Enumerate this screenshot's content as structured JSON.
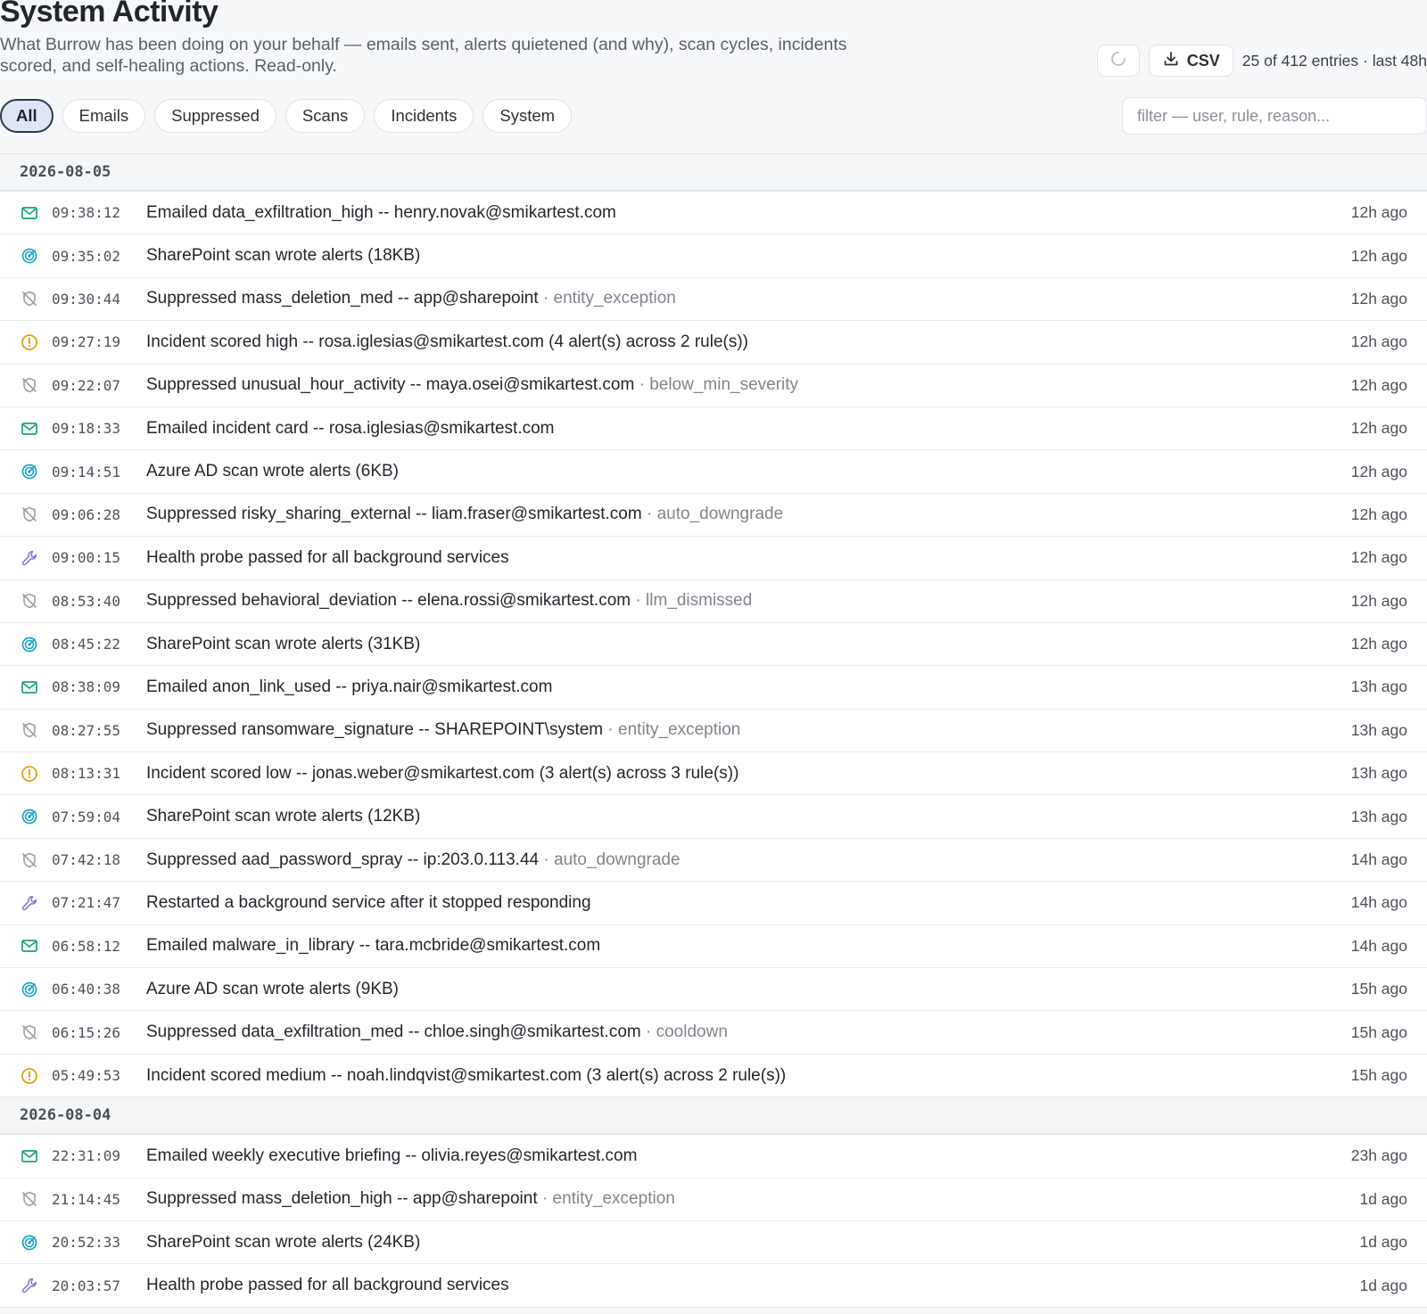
{
  "page": {
    "title": "System Activity",
    "subtitle": "What Burrow has been doing on your behalf — emails sent, alerts quietened (and why), scan cycles, incidents scored, and self-healing actions. Read-only.",
    "csv_label": "CSV",
    "entries_text": "25 of 412 entries · last 48h"
  },
  "filters": {
    "chips": [
      "All",
      "Emails",
      "Suppressed",
      "Scans",
      "Incidents",
      "System"
    ],
    "active": "All",
    "placeholder": "filter — user, rule, reason..."
  },
  "colors": {
    "email": "#1aa37a",
    "scan": "#1ba3c6",
    "suppressed": "#9aa0a8",
    "incident": "#e3a008",
    "system": "#8b6fd1"
  },
  "groups": [
    {
      "date": "2026-08-05",
      "rows": [
        {
          "type": "email",
          "time": "09:38:12",
          "msg": "Emailed data_exfiltration_high -- henry.novak@smikartest.com",
          "reason": "",
          "ago": "12h ago"
        },
        {
          "type": "scan",
          "time": "09:35:02",
          "msg": "SharePoint scan wrote alerts (18KB)",
          "reason": "",
          "ago": "12h ago"
        },
        {
          "type": "suppressed",
          "time": "09:30:44",
          "msg": "Suppressed mass_deletion_med -- app@sharepoint",
          "reason": "entity_exception",
          "ago": "12h ago"
        },
        {
          "type": "incident",
          "time": "09:27:19",
          "msg": "Incident scored high -- rosa.iglesias@smikartest.com (4 alert(s) across 2 rule(s))",
          "reason": "",
          "ago": "12h ago"
        },
        {
          "type": "suppressed",
          "time": "09:22:07",
          "msg": "Suppressed unusual_hour_activity -- maya.osei@smikartest.com",
          "reason": "below_min_severity",
          "ago": "12h ago"
        },
        {
          "type": "email",
          "time": "09:18:33",
          "msg": "Emailed incident card -- rosa.iglesias@smikartest.com",
          "reason": "",
          "ago": "12h ago"
        },
        {
          "type": "scan",
          "time": "09:14:51",
          "msg": "Azure AD scan wrote alerts (6KB)",
          "reason": "",
          "ago": "12h ago"
        },
        {
          "type": "suppressed",
          "time": "09:06:28",
          "msg": "Suppressed risky_sharing_external -- liam.fraser@smikartest.com",
          "reason": "auto_downgrade",
          "ago": "12h ago"
        },
        {
          "type": "system",
          "time": "09:00:15",
          "msg": "Health probe passed for all background services",
          "reason": "",
          "ago": "12h ago"
        },
        {
          "type": "suppressed",
          "time": "08:53:40",
          "msg": "Suppressed behavioral_deviation -- elena.rossi@smikartest.com",
          "reason": "llm_dismissed",
          "ago": "12h ago"
        },
        {
          "type": "scan",
          "time": "08:45:22",
          "msg": "SharePoint scan wrote alerts (31KB)",
          "reason": "",
          "ago": "12h ago"
        },
        {
          "type": "email",
          "time": "08:38:09",
          "msg": "Emailed anon_link_used -- priya.nair@smikartest.com",
          "reason": "",
          "ago": "13h ago"
        },
        {
          "type": "suppressed",
          "time": "08:27:55",
          "msg": "Suppressed ransomware_signature -- SHAREPOINT\\system",
          "reason": "entity_exception",
          "ago": "13h ago"
        },
        {
          "type": "incident",
          "time": "08:13:31",
          "msg": "Incident scored low -- jonas.weber@smikartest.com (3 alert(s) across 3 rule(s))",
          "reason": "",
          "ago": "13h ago"
        },
        {
          "type": "scan",
          "time": "07:59:04",
          "msg": "SharePoint scan wrote alerts (12KB)",
          "reason": "",
          "ago": "13h ago"
        },
        {
          "type": "suppressed",
          "time": "07:42:18",
          "msg": "Suppressed aad_password_spray -- ip:203.0.113.44",
          "reason": "auto_downgrade",
          "ago": "14h ago"
        },
        {
          "type": "system",
          "time": "07:21:47",
          "msg": "Restarted a background service after it stopped responding",
          "reason": "",
          "ago": "14h ago"
        },
        {
          "type": "email",
          "time": "06:58:12",
          "msg": "Emailed malware_in_library -- tara.mcbride@smikartest.com",
          "reason": "",
          "ago": "14h ago"
        },
        {
          "type": "scan",
          "time": "06:40:38",
          "msg": "Azure AD scan wrote alerts (9KB)",
          "reason": "",
          "ago": "15h ago"
        },
        {
          "type": "suppressed",
          "time": "06:15:26",
          "msg": "Suppressed data_exfiltration_med -- chloe.singh@smikartest.com",
          "reason": "cooldown",
          "ago": "15h ago"
        },
        {
          "type": "incident",
          "time": "05:49:53",
          "msg": "Incident scored medium -- noah.lindqvist@smikartest.com (3 alert(s) across 2 rule(s))",
          "reason": "",
          "ago": "15h ago"
        }
      ]
    },
    {
      "date": "2026-08-04",
      "rows": [
        {
          "type": "email",
          "time": "22:31:09",
          "msg": "Emailed weekly executive briefing -- olivia.reyes@smikartest.com",
          "reason": "",
          "ago": "23h ago"
        },
        {
          "type": "suppressed",
          "time": "21:14:45",
          "msg": "Suppressed mass_deletion_high -- app@sharepoint",
          "reason": "entity_exception",
          "ago": "1d ago"
        },
        {
          "type": "scan",
          "time": "20:52:33",
          "msg": "SharePoint scan wrote alerts (24KB)",
          "reason": "",
          "ago": "1d ago"
        },
        {
          "type": "system",
          "time": "20:03:57",
          "msg": "Health probe passed for all background services",
          "reason": "",
          "ago": "1d ago"
        }
      ]
    }
  ]
}
